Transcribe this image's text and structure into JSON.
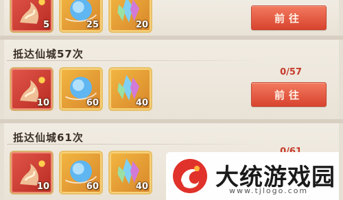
{
  "tasks": [
    {
      "title": "",
      "progress": "",
      "button": "前往",
      "rewards": [
        {
          "kind": "red-dragon",
          "count": "5"
        },
        {
          "kind": "blue-orb",
          "count": "25"
        },
        {
          "kind": "crystal",
          "count": "20"
        }
      ]
    },
    {
      "title": "抵达仙城57次",
      "progress": "0/57",
      "button": "前往",
      "rewards": [
        {
          "kind": "red-dragon",
          "count": "10"
        },
        {
          "kind": "blue-orb",
          "count": "60"
        },
        {
          "kind": "crystal",
          "count": "40"
        }
      ]
    },
    {
      "title": "抵达仙城61次",
      "progress": "0/61",
      "button": "",
      "rewards": [
        {
          "kind": "red-dragon",
          "count": "10"
        },
        {
          "kind": "blue-orb",
          "count": "60"
        },
        {
          "kind": "crystal",
          "count": "40"
        }
      ]
    }
  ],
  "watermark": {
    "site_name": "大统游戏园",
    "url": "www.tjlogo.com",
    "logo_icon": "red-swirl-logo-icon"
  },
  "colors": {
    "button": "#e05a42",
    "progress": "#c63a2a",
    "card_red": "#c9352b",
    "card_gold": "#e9a43a"
  }
}
